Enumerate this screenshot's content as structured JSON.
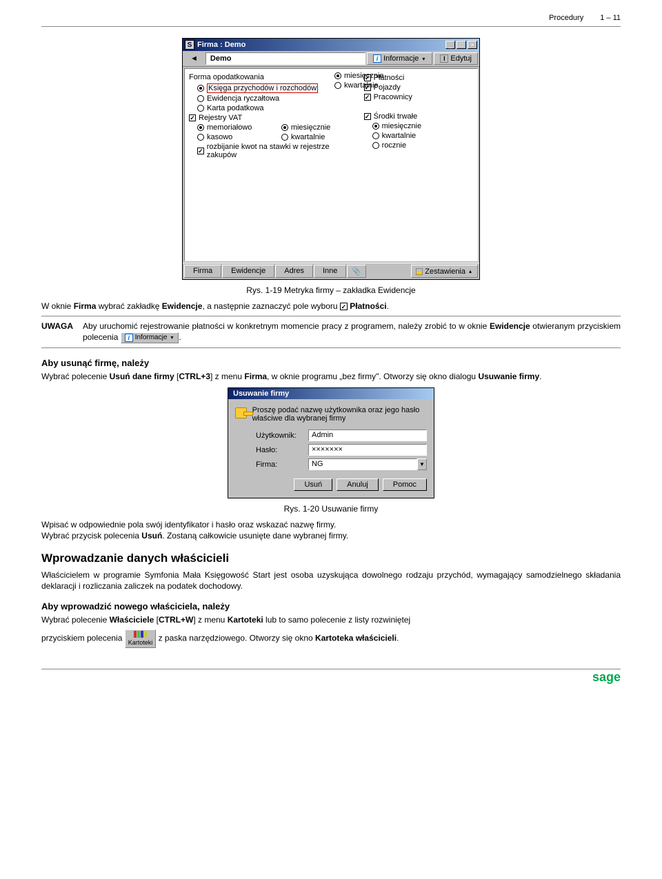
{
  "header": {
    "section": "Procedury",
    "page": "1 – 11"
  },
  "win1": {
    "title": "Firma : Demo",
    "s_icon": "S",
    "demo_field": "Demo",
    "btn_info": "Informacje",
    "btn_edit": "Edytuj",
    "lbl_forma": "Forma opodatkowania",
    "r_ksiega": "Księga przychodów i rozchodów",
    "r_ewid": "Ewidencja ryczałtowa",
    "r_karta": "Karta podatkowa",
    "c_rejestry": "Rejestry VAT",
    "r_memo": "memoriałowo",
    "r_kasowo": "kasowo",
    "c_rozbij": "rozbijanie kwot na stawki w rejestrze zakupów",
    "r_mies": "miesięcznie",
    "r_kwart": "kwartalnie",
    "c_plat": "Płatności",
    "c_pojazdy": "Pojazdy",
    "c_prac": "Pracownicy",
    "c_srodki": "Środki trwałe",
    "r_mies2": "miesięcznie",
    "r_kwart2": "kwartalnie",
    "r_roczn": "rocznie",
    "tab_firma": "Firma",
    "tab_ewid": "Ewidencje",
    "tab_adres": "Adres",
    "tab_inne": "Inne",
    "tab_zest": "Zestawienia"
  },
  "cap1": "Rys. 1-19 Metryka firmy – zakładka Ewidencje",
  "p1a": "W oknie ",
  "p1b": "Firma",
  "p1c": " wybrać zakładkę ",
  "p1d": "Ewidencje",
  "p1e": ", a następnie zaznaczyć pole wyboru ",
  "p1f": "Płatności",
  "p1g": ".",
  "uwaga": {
    "label": "UWAGA",
    "t1": "Aby uruchomić rejestrowanie płatności w konkretnym momencie pracy z programem, należy zrobić to w oknie ",
    "t2": "Ewidencje",
    "t3": " otwieranym przyciskiem polecenia ",
    "t4": "Informacje",
    "t5": "."
  },
  "h_usun": "Aby usunąć firmę, należy",
  "p2a": "Wybrać polecenie ",
  "p2b": "Usuń dane firmy",
  "p2c": " [",
  "p2d": "CTRL+3",
  "p2e": "] z menu ",
  "p2f": "Firma",
  "p2g": ", w oknie programu „bez firmy\". Otworzy się okno dialogu ",
  "p2h": "Usuwanie firmy",
  "p2i": ".",
  "dlg": {
    "title": "Usuwanie firmy",
    "msg": "Proszę podać nazwę użytkownika oraz jego hasło właściwe dla wybranej firmy",
    "l_user": "Użytkownik:",
    "v_user": "Admin",
    "l_pass": "Hasło:",
    "v_pass": "×××××××",
    "l_firma": "Firma:",
    "v_firma": "NG",
    "b_usun": "Usuń",
    "b_anul": "Anuluj",
    "b_pomoc": "Pomoc"
  },
  "cap2": "Rys. 1-20 Usuwanie firmy",
  "p3": "Wpisać w odpowiednie pola swój identyfikator i hasło oraz wskazać nazwę firmy.",
  "p4a": "Wybrać przycisk polecenia ",
  "p4b": "Usuń",
  "p4c": ". Zostaną całkowicie usunięte dane wybranej firmy.",
  "h_wpr": "Wprowadzanie danych właścicieli",
  "p5": "Właścicielem w programie Symfonia Mała Księgowość Start jest osoba uzyskująca dowolnego rodzaju przychód, wymagający samodzielnego składania deklaracji i rozliczania zaliczek na podatek dochodowy.",
  "h_nowy": "Aby wprowadzić nowego właściciela, należy",
  "p6a": "Wybrać polecenie ",
  "p6b": "Właściciele",
  "p6c": " [",
  "p6d": "CTRL+W",
  "p6e": "] z menu ",
  "p6f": "Kartoteki",
  "p6g": " lub to samo polecenie z listy rozwiniętej",
  "p7a": "przyciskiem polecenia ",
  "p7b": "Kartoteki",
  "p7c": " z paska narzędziowego. Otworzy się okno ",
  "p7d": "Kartoteka właścicieli",
  "p7e": ".",
  "footer_logo": "sage"
}
